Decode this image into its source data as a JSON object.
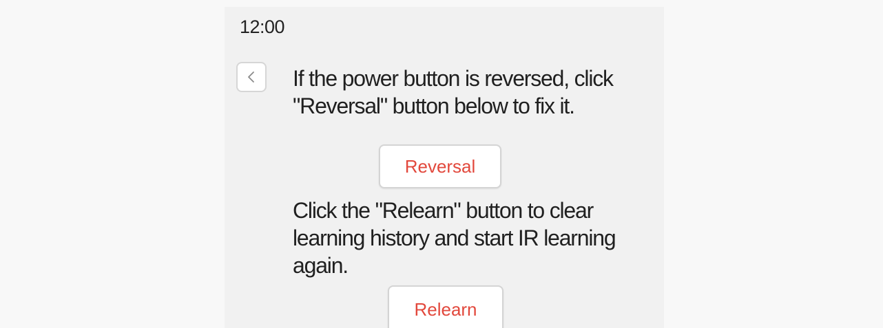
{
  "status_bar": {
    "time": "12:00"
  },
  "navigation": {
    "back_icon": "chevron-left-icon"
  },
  "instructions": {
    "reversal_text": "If the power button is reversed, click \"Reversal\" button below to fix it.",
    "relearn_text": "Click the \"Relearn\" button to clear learning history and start IR learning again."
  },
  "actions": {
    "reversal_label": "Reversal",
    "relearn_label": "Relearn"
  },
  "colors": {
    "accent": "#e2483c"
  }
}
